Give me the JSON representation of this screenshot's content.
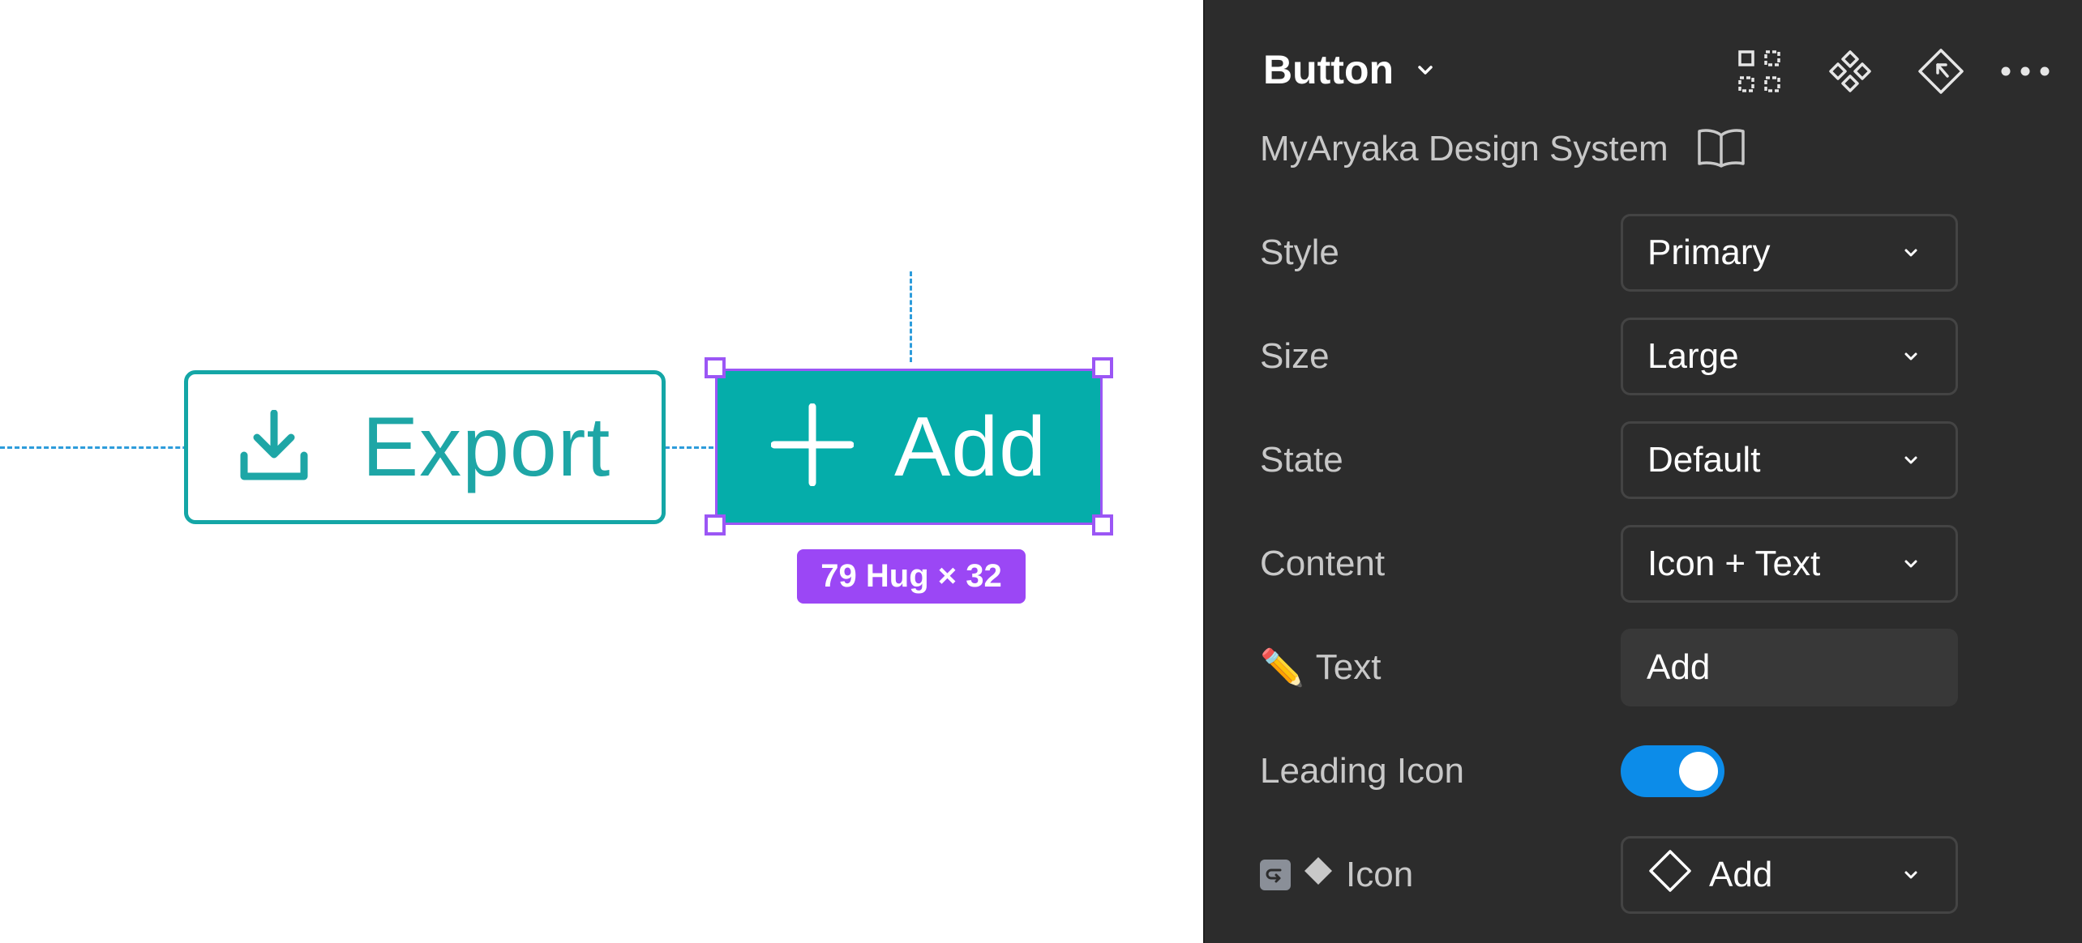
{
  "canvas": {
    "export_button": {
      "label": "Export",
      "icon": "download-icon"
    },
    "add_button": {
      "label": "Add",
      "icon": "plus-icon"
    },
    "size_badge": "79 Hug × 32",
    "colors": {
      "teal": "#05adaa",
      "selection": "#9b56f5",
      "guide": "#2d9cdb"
    }
  },
  "panel": {
    "title": "Button",
    "library": "MyAryaka Design System",
    "header_icons": [
      "select-instances-icon",
      "component-icon",
      "go-to-main-component-icon",
      "more-options-icon"
    ],
    "properties": {
      "style": {
        "label": "Style",
        "value": "Primary"
      },
      "size": {
        "label": "Size",
        "value": "Large"
      },
      "state": {
        "label": "State",
        "value": "Default"
      },
      "content": {
        "label": "Content",
        "value": "Icon + Text"
      },
      "text": {
        "label": "Text",
        "icon": "✏️",
        "value": "Add"
      },
      "leading_icon": {
        "label": "Leading Icon",
        "enabled": true
      },
      "icon": {
        "label": "Icon",
        "value": "Add"
      }
    },
    "colors": {
      "background": "#2c2c2c",
      "toggle_on": "#0c8ce9"
    }
  }
}
